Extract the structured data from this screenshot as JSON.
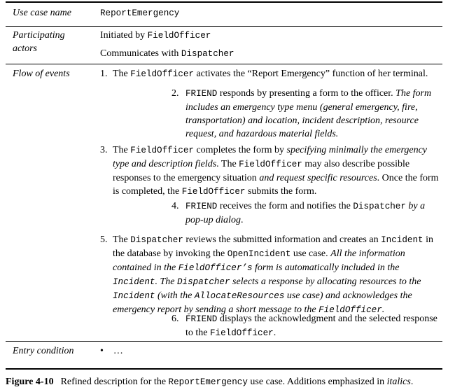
{
  "rows": {
    "use_case_name": {
      "label": "Use case name",
      "value": "ReportEmergency"
    },
    "participating_actors": {
      "label": "Participating actors",
      "line1_prefix": "Initiated by ",
      "line1_actor": "FieldOfficer",
      "line2_prefix": "Communicates with ",
      "line2_actor": "Dispatcher"
    },
    "flow_of_events": {
      "label": "Flow of events"
    },
    "entry_condition": {
      "label": "Entry condition",
      "bullet": "•",
      "value": "…"
    }
  },
  "steps": {
    "s1": {
      "num": "1.",
      "a": "The ",
      "b": "FieldOfficer",
      "c": " activates the “Report Emergency” function of her terminal."
    },
    "s2": {
      "num": "2.",
      "a": "FRIEND",
      "b": " responds by presenting a form to the officer. ",
      "c": "The form includes an emergency type menu (general emergency, fire, transportation) and location, incident description, resource request, and hazardous material fields."
    },
    "s3": {
      "num": "3.",
      "a": "The ",
      "b": "FieldOfficer",
      "c": " completes the form by ",
      "d": "specifying minimally the emergency type and description fields",
      "e": ". The ",
      "f": "FieldOfficer",
      "g": " may also describe possible responses to the emergency situation ",
      "h": "and request specific resources",
      "i": ". Once the form is completed, the ",
      "j": "FieldOfficer",
      "k": " submits the form."
    },
    "s4": {
      "num": "4.",
      "a": "FRIEND",
      "b": " receives the form and notifies the ",
      "c": "Dispatcher",
      "d": " ",
      "e": "by a pop-up dialog",
      "f": "."
    },
    "s5": {
      "num": "5.",
      "a": "The ",
      "b": "Dispatcher",
      "c": " reviews the submitted information and creates an ",
      "d": "Incident",
      "e": " in the database by invoking the ",
      "f": "OpenIncident",
      "g": " use case. ",
      "h": "All the information contained in the ",
      "i": "FieldOfficer’s",
      "j": " form is automatically included in the ",
      "k": "Incident",
      "l": ". The ",
      "m": "Dispatcher",
      "n": " selects a response by allocating resources to the ",
      "o": "Incident",
      "p": " (with the ",
      "q": "AllocateResources",
      "r": " use case) and acknowledges the emergency report by sending a short message to the ",
      "s": "FieldOfficer",
      "t": "."
    },
    "s6": {
      "num": "6.",
      "a": "FRIEND",
      "b": " displays the acknowledgment and the selected response to the ",
      "c": "FieldOfficer",
      "d": "."
    }
  },
  "caption": {
    "figure": "Figure 4-10",
    "text1": "Refined description for the ",
    "usecase": "ReportEmergency",
    "text2": " use case. Additions emphasized in ",
    "italics": "italics",
    "text3": "."
  }
}
